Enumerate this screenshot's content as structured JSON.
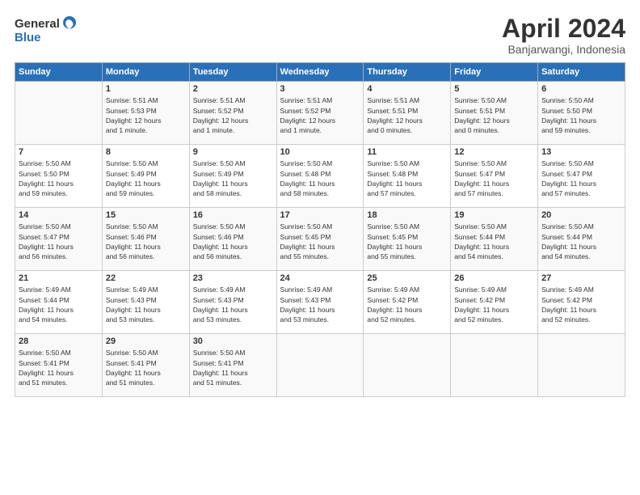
{
  "logo": {
    "line1": "General",
    "line2": "Blue"
  },
  "title": "April 2024",
  "subtitle": "Banjarwangi, Indonesia",
  "days_header": [
    "Sunday",
    "Monday",
    "Tuesday",
    "Wednesday",
    "Thursday",
    "Friday",
    "Saturday"
  ],
  "weeks": [
    [
      {
        "num": "",
        "info": ""
      },
      {
        "num": "1",
        "info": "Sunrise: 5:51 AM\nSunset: 5:53 PM\nDaylight: 12 hours\nand 1 minute."
      },
      {
        "num": "2",
        "info": "Sunrise: 5:51 AM\nSunset: 5:52 PM\nDaylight: 12 hours\nand 1 minute."
      },
      {
        "num": "3",
        "info": "Sunrise: 5:51 AM\nSunset: 5:52 PM\nDaylight: 12 hours\nand 1 minute."
      },
      {
        "num": "4",
        "info": "Sunrise: 5:51 AM\nSunset: 5:51 PM\nDaylight: 12 hours\nand 0 minutes."
      },
      {
        "num": "5",
        "info": "Sunrise: 5:50 AM\nSunset: 5:51 PM\nDaylight: 12 hours\nand 0 minutes."
      },
      {
        "num": "6",
        "info": "Sunrise: 5:50 AM\nSunset: 5:50 PM\nDaylight: 11 hours\nand 59 minutes."
      }
    ],
    [
      {
        "num": "7",
        "info": "Sunrise: 5:50 AM\nSunset: 5:50 PM\nDaylight: 11 hours\nand 59 minutes."
      },
      {
        "num": "8",
        "info": "Sunrise: 5:50 AM\nSunset: 5:49 PM\nDaylight: 11 hours\nand 59 minutes."
      },
      {
        "num": "9",
        "info": "Sunrise: 5:50 AM\nSunset: 5:49 PM\nDaylight: 11 hours\nand 58 minutes."
      },
      {
        "num": "10",
        "info": "Sunrise: 5:50 AM\nSunset: 5:48 PM\nDaylight: 11 hours\nand 58 minutes."
      },
      {
        "num": "11",
        "info": "Sunrise: 5:50 AM\nSunset: 5:48 PM\nDaylight: 11 hours\nand 57 minutes."
      },
      {
        "num": "12",
        "info": "Sunrise: 5:50 AM\nSunset: 5:47 PM\nDaylight: 11 hours\nand 57 minutes."
      },
      {
        "num": "13",
        "info": "Sunrise: 5:50 AM\nSunset: 5:47 PM\nDaylight: 11 hours\nand 57 minutes."
      }
    ],
    [
      {
        "num": "14",
        "info": "Sunrise: 5:50 AM\nSunset: 5:47 PM\nDaylight: 11 hours\nand 56 minutes."
      },
      {
        "num": "15",
        "info": "Sunrise: 5:50 AM\nSunset: 5:46 PM\nDaylight: 11 hours\nand 56 minutes."
      },
      {
        "num": "16",
        "info": "Sunrise: 5:50 AM\nSunset: 5:46 PM\nDaylight: 11 hours\nand 56 minutes."
      },
      {
        "num": "17",
        "info": "Sunrise: 5:50 AM\nSunset: 5:45 PM\nDaylight: 11 hours\nand 55 minutes."
      },
      {
        "num": "18",
        "info": "Sunrise: 5:50 AM\nSunset: 5:45 PM\nDaylight: 11 hours\nand 55 minutes."
      },
      {
        "num": "19",
        "info": "Sunrise: 5:50 AM\nSunset: 5:44 PM\nDaylight: 11 hours\nand 54 minutes."
      },
      {
        "num": "20",
        "info": "Sunrise: 5:50 AM\nSunset: 5:44 PM\nDaylight: 11 hours\nand 54 minutes."
      }
    ],
    [
      {
        "num": "21",
        "info": "Sunrise: 5:49 AM\nSunset: 5:44 PM\nDaylight: 11 hours\nand 54 minutes."
      },
      {
        "num": "22",
        "info": "Sunrise: 5:49 AM\nSunset: 5:43 PM\nDaylight: 11 hours\nand 53 minutes."
      },
      {
        "num": "23",
        "info": "Sunrise: 5:49 AM\nSunset: 5:43 PM\nDaylight: 11 hours\nand 53 minutes."
      },
      {
        "num": "24",
        "info": "Sunrise: 5:49 AM\nSunset: 5:43 PM\nDaylight: 11 hours\nand 53 minutes."
      },
      {
        "num": "25",
        "info": "Sunrise: 5:49 AM\nSunset: 5:42 PM\nDaylight: 11 hours\nand 52 minutes."
      },
      {
        "num": "26",
        "info": "Sunrise: 5:49 AM\nSunset: 5:42 PM\nDaylight: 11 hours\nand 52 minutes."
      },
      {
        "num": "27",
        "info": "Sunrise: 5:49 AM\nSunset: 5:42 PM\nDaylight: 11 hours\nand 52 minutes."
      }
    ],
    [
      {
        "num": "28",
        "info": "Sunrise: 5:50 AM\nSunset: 5:41 PM\nDaylight: 11 hours\nand 51 minutes."
      },
      {
        "num": "29",
        "info": "Sunrise: 5:50 AM\nSunset: 5:41 PM\nDaylight: 11 hours\nand 51 minutes."
      },
      {
        "num": "30",
        "info": "Sunrise: 5:50 AM\nSunset: 5:41 PM\nDaylight: 11 hours\nand 51 minutes."
      },
      {
        "num": "",
        "info": ""
      },
      {
        "num": "",
        "info": ""
      },
      {
        "num": "",
        "info": ""
      },
      {
        "num": "",
        "info": ""
      }
    ]
  ]
}
